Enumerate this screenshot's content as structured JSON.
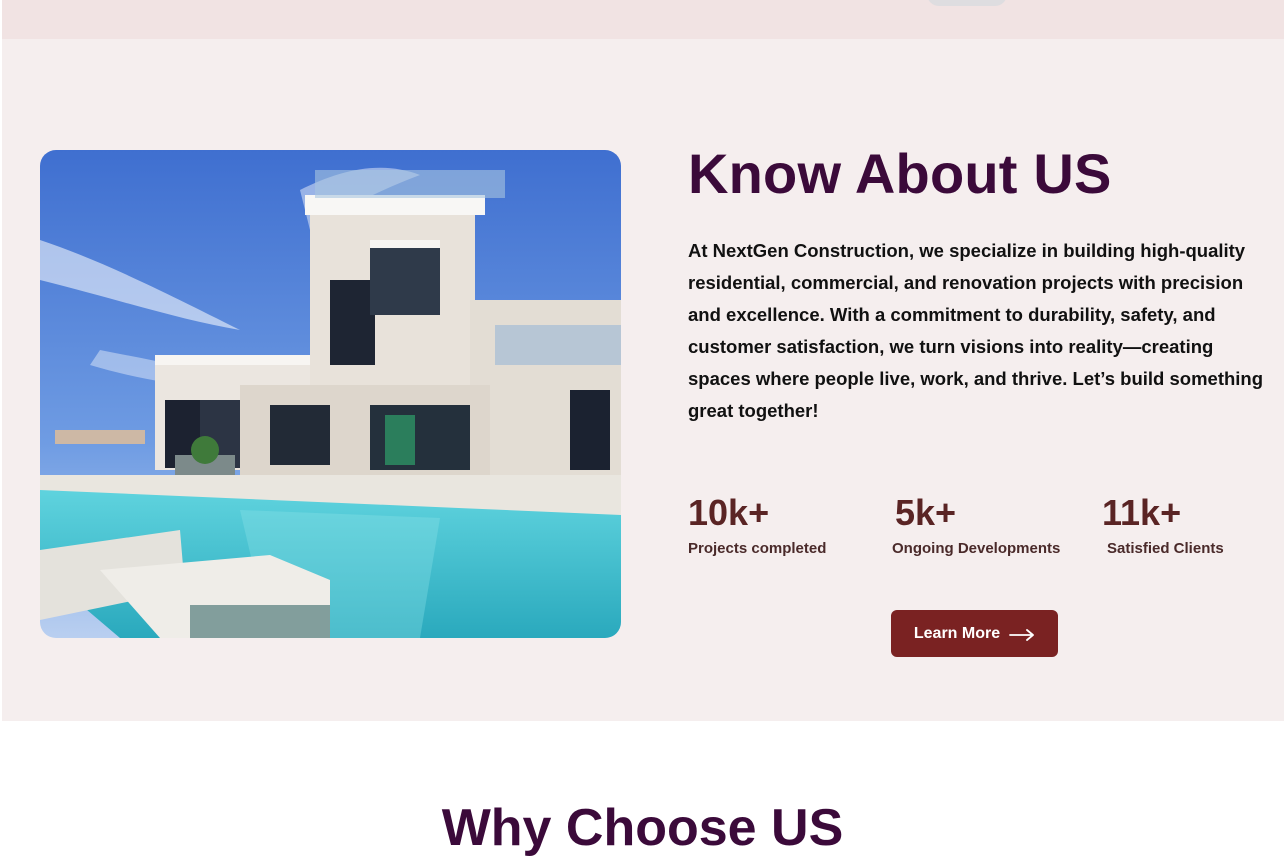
{
  "about": {
    "title": "Know About US",
    "description": "At NextGen Construction, we specialize in building high-quality residential, commercial, and renovation projects with precision and excellence. With a commitment to durability, safety, and customer satisfaction, we turn visions into reality—creating spaces where people live, work, and thrive. Let’s build something great together!",
    "stats": [
      {
        "value": "10k+",
        "label": "Projects completed"
      },
      {
        "value": "5k+",
        "label": "Ongoing Developments"
      },
      {
        "value": "11k+",
        "label": "Satisfied Clients"
      }
    ],
    "button_label": "Learn More",
    "button_icon": "arrow-right-icon",
    "image_subject": "modern white villa with swimming pool"
  },
  "why": {
    "title": "Why Choose US"
  },
  "colors": {
    "title": "#3b0a3a",
    "stat_number": "#5a2424",
    "button_bg": "#7a2222",
    "section_bg": "#f5eeee",
    "top_strip_bg": "#f1e3e3"
  }
}
